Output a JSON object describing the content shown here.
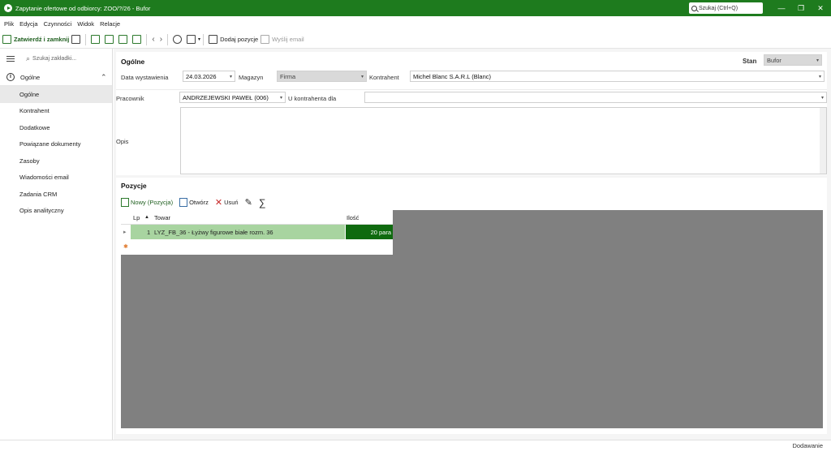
{
  "window": {
    "title": "Zapytanie ofertowe od odbiorcy: ZOO/?/26 - Bufor",
    "search_placeholder": "Szukaj (Ctrl+Q)"
  },
  "menu": [
    "Plik",
    "Edycja",
    "Czynności",
    "Widok",
    "Relacje"
  ],
  "toolbar": {
    "save_close": "Zatwierdź i zamknij",
    "add_items": "Dodaj pozycje",
    "send_email": "Wyślij email"
  },
  "sidebar": {
    "search_placeholder": "Szukaj zakładki...",
    "group_label": "Ogólne",
    "items": [
      "Ogólne",
      "Kontrahent",
      "Dodatkowe",
      "Powiązane dokumenty",
      "Zasoby",
      "Wiadomości email",
      "Zadania CRM",
      "Opis analityczny"
    ]
  },
  "general": {
    "header": "Ogólne",
    "state_label": "Stan",
    "state_value": "Bufor",
    "issue_date_label": "Data wystawienia",
    "issue_date_value": "24.03.2026",
    "warehouse_label": "Magazyn",
    "warehouse_value": "Firma",
    "contractor_label": "Kontrahent",
    "contractor_value": "Michel Blanc S.A.R.L (Blanc)",
    "employee_label": "Pracownik",
    "employee_value": "ANDRZEJEWSKI PAWEŁ (006)",
    "at_contractor_label": "U kontrahenta dla",
    "at_contractor_value": "",
    "description_label": "Opis"
  },
  "positions": {
    "header": "Pozycje",
    "new_label": "Nowy (Pozycja)",
    "open_label": "Otwórz",
    "delete_label": "Usuń",
    "columns": {
      "lp": "Lp",
      "product": "Towar",
      "qty": "Ilość"
    },
    "rows": [
      {
        "lp": "1",
        "product": "LYZ_FB_36 - Łyżwy figurowe białe rozm. 36",
        "qty": "20 para"
      }
    ]
  },
  "status": {
    "mode": "Dodawanie"
  },
  "colors": {
    "accent": "#1e7b1e",
    "selected_row": "#a8d4a0",
    "qty_cell": "#0f6a0f"
  }
}
